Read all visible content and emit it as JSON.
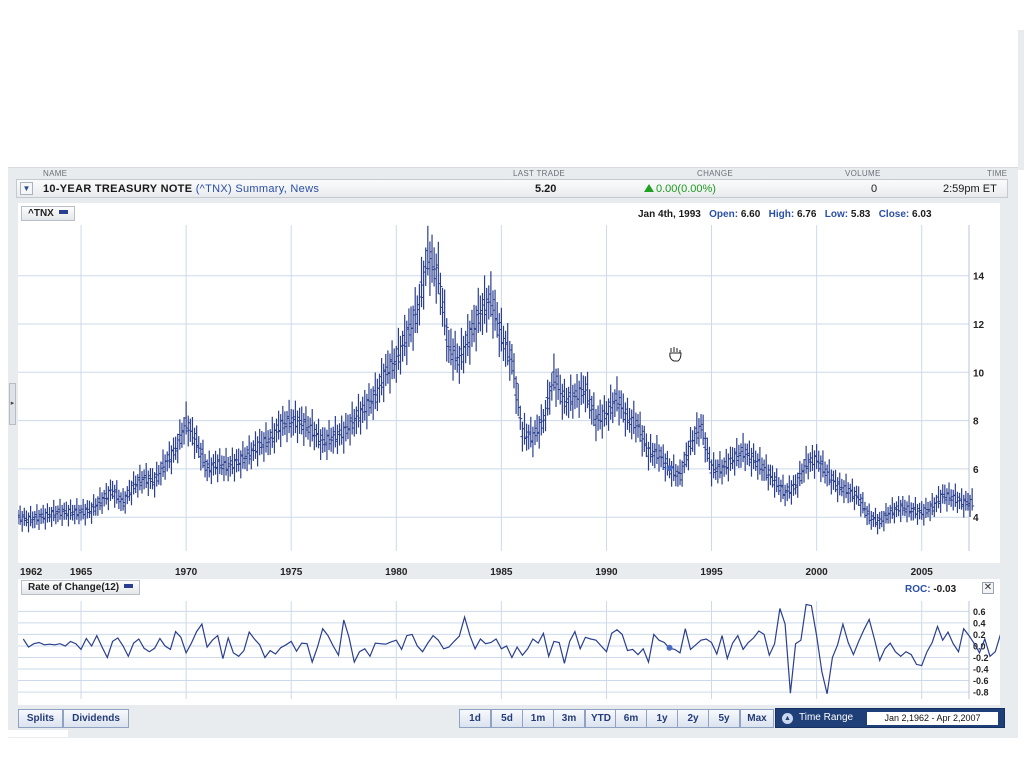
{
  "header": {
    "columns": {
      "name": "NAME",
      "last_trade": "LAST TRADE",
      "change": "CHANGE",
      "volume": "VOLUME",
      "time": "TIME"
    },
    "security_name": "10-YEAR TREASURY NOTE",
    "symbol": "(^TNX)",
    "link_summary": "Summary",
    "link_separator": ",",
    "link_news": "News",
    "last_trade": "5.20",
    "change": "0.00(0.00%)",
    "volume": "0",
    "time": "2:59pm ET"
  },
  "main_chart": {
    "badge": "^TNX",
    "info": {
      "date": "Jan 4th, 1993",
      "open_label": "Open:",
      "open": "6.60",
      "high_label": "High:",
      "high": "6.76",
      "low_label": "Low:",
      "low": "5.83",
      "close_label": "Close:",
      "close": "6.03"
    }
  },
  "roc_chart": {
    "badge": "Rate of Change(12)",
    "value_label": "ROC:",
    "value": "-0.03"
  },
  "close_symbol": "✕",
  "toolbar": {
    "splits": "Splits",
    "dividends": "Dividends",
    "ranges": [
      "1d",
      "5d",
      "1m",
      "3m",
      "YTD",
      "6m",
      "1y",
      "2y",
      "5y",
      "Max"
    ],
    "time_range_label": "Time Range",
    "time_range_value": "Jan 2,1962 - Apr 2,2007"
  },
  "colors": {
    "line": "#2a3f8f",
    "grid": "#cdd9ea",
    "accent": "#1f3f78",
    "up": "#20a020"
  },
  "icons": {
    "hand_cursor": "hand-icon"
  },
  "chart_data": [
    {
      "type": "line",
      "series_style": "ohlc-bars",
      "title": "",
      "xlabel": "",
      "ylabel": "",
      "x_ticks": [
        1962,
        1965,
        1970,
        1975,
        1980,
        1985,
        1990,
        1995,
        2000,
        2005
      ],
      "y_ticks": [
        4,
        6,
        8,
        10,
        12,
        14
      ],
      "xlim": [
        1962,
        2007.25
      ],
      "ylim": [
        2.6,
        16.1
      ],
      "y_axis_position": "right",
      "grid": true,
      "x": [
        1962,
        1962.5,
        1963,
        1963.5,
        1964,
        1964.5,
        1965,
        1965.5,
        1966,
        1966.5,
        1967,
        1967.5,
        1968,
        1968.5,
        1969,
        1969.5,
        1970,
        1970.5,
        1971,
        1971.5,
        1972,
        1972.5,
        1973,
        1973.5,
        1974,
        1974.5,
        1975,
        1975.5,
        1976,
        1976.5,
        1977,
        1977.5,
        1978,
        1978.5,
        1979,
        1979.5,
        1980,
        1980.5,
        1981,
        1981.5,
        1982,
        1982.5,
        1983,
        1983.5,
        1984,
        1984.5,
        1985,
        1985.5,
        1986,
        1986.5,
        1987,
        1987.5,
        1988,
        1988.5,
        1989,
        1989.5,
        1990,
        1990.5,
        1991,
        1991.5,
        1992,
        1992.5,
        1993,
        1993.5,
        1994,
        1994.5,
        1995,
        1995.5,
        1996,
        1996.5,
        1997,
        1997.5,
        1998,
        1998.5,
        1999,
        1999.5,
        2000,
        2000.5,
        2001,
        2001.5,
        2002,
        2002.5,
        2003,
        2003.5,
        2004,
        2004.5,
        2005,
        2005.5,
        2006,
        2006.5,
        2007
      ],
      "values": [
        4.0,
        3.9,
        4.0,
        4.1,
        4.2,
        4.2,
        4.2,
        4.3,
        4.7,
        5.1,
        4.6,
        5.3,
        5.6,
        5.5,
        6.2,
        6.8,
        7.9,
        7.1,
        6.0,
        6.2,
        6.1,
        6.3,
        6.6,
        7.0,
        7.2,
        7.8,
        8.0,
        7.9,
        7.6,
        7.1,
        7.3,
        7.5,
        8.0,
        8.5,
        9.0,
        10.0,
        10.5,
        11.5,
        12.5,
        14.8,
        14.0,
        11.0,
        10.5,
        11.5,
        12.5,
        13.0,
        11.5,
        10.5,
        7.5,
        7.3,
        8.0,
        9.8,
        8.8,
        9.0,
        9.3,
        8.0,
        8.3,
        8.9,
        8.1,
        7.8,
        6.7,
        6.6,
        6.0,
        5.7,
        7.0,
        7.8,
        6.0,
        6.0,
        6.4,
        6.7,
        6.4,
        6.0,
        5.5,
        5.0,
        5.3,
        6.2,
        6.4,
        5.8,
        5.3,
        5.1,
        4.8,
        4.0,
        3.8,
        4.2,
        4.4,
        4.3,
        4.2,
        4.4,
        4.9,
        4.8,
        4.6
      ],
      "highlight": {
        "x": 1993.0,
        "y": 6.03
      }
    },
    {
      "type": "line",
      "title": "",
      "series": [
        {
          "name": "Rate of Change(12)"
        }
      ],
      "y_ticks": [
        0.6,
        0.4,
        0.2,
        0.0,
        -0.2,
        -0.4,
        -0.6,
        -0.8
      ],
      "ylim": [
        -0.92,
        0.78
      ],
      "y_axis_position": "right",
      "grid": true,
      "xlim": [
        1962,
        2007.25
      ],
      "x_start": 1962.25,
      "x_step": 0.25,
      "values": [
        0.12,
        -0.02,
        0.04,
        0.06,
        0.02,
        0.03,
        0.02,
        0.04,
        0.0,
        0.08,
        0.04,
        -0.06,
        0.13,
        0.0,
        0.18,
        -0.02,
        -0.2,
        0.08,
        0.14,
        0.0,
        -0.18,
        0.05,
        0.12,
        -0.04,
        -0.1,
        -0.04,
        0.13,
        0.0,
        -0.06,
        0.25,
        0.15,
        -0.12,
        0.05,
        0.25,
        0.38,
        -0.02,
        0.1,
        0.18,
        -0.22,
        0.14,
        -0.12,
        -0.18,
        -0.08,
        0.24,
        0.12,
        0.02,
        -0.2,
        -0.08,
        -0.14,
        -0.03,
        0.02,
        0.08,
        -0.09,
        0.05,
        0.04,
        -0.28,
        -0.02,
        0.3,
        0.18,
        0.0,
        -0.16,
        0.45,
        0.15,
        -0.28,
        -0.1,
        -0.05,
        -0.18,
        0.05,
        0.04,
        0.03,
        0.07,
        0.1,
        -0.06,
        0.18,
        0.2,
        0.0,
        -0.1,
        0.05,
        0.18,
        0.1,
        -0.05,
        -0.02,
        0.08,
        0.17,
        0.5,
        0.18,
        -0.05,
        0.12,
        0.04,
        0.06,
        0.12,
        -0.05,
        0.0,
        -0.2,
        -0.02,
        -0.16,
        -0.05,
        0.12,
        0.05,
        0.22,
        -0.18,
        0.08,
        0.06,
        -0.3,
        0.08,
        0.25,
        -0.05,
        0.15,
        0.12,
        0.1,
        0.0,
        -0.1,
        0.22,
        0.28,
        0.2,
        -0.08,
        -0.06,
        -0.15,
        -0.05,
        -0.28,
        0.2,
        0.1,
        0.06,
        -0.04,
        -0.06,
        -0.12,
        0.3,
        -0.06,
        0.02,
        0.1,
        0.12,
        0.06,
        -0.14,
        0.18,
        -0.22,
        0.05,
        0.18,
        -0.06,
        0.06,
        0.14,
        0.26,
        0.2,
        -0.16,
        0.04,
        0.65,
        0.38,
        -0.82,
        0.04,
        0.1,
        0.72,
        0.7,
        0.18,
        -0.45,
        -0.83,
        -0.2,
        0.02,
        0.38,
        0.06,
        -0.15,
        0.08,
        0.28,
        0.46,
        0.12,
        -0.25,
        -0.05,
        0.05,
        -0.1,
        -0.18,
        -0.1,
        -0.15,
        -0.32,
        -0.34,
        -0.1,
        0.06,
        0.34,
        0.1,
        0.24,
        0.04,
        -0.1,
        0.3,
        0.18,
        0.04,
        -0.12,
        0.12,
        -0.18,
        -0.1,
        0.2,
        0.05,
        0.02,
        -0.18,
        0.25,
        0.18,
        0.1,
        0.02,
        -0.06,
        0.1,
        0.12,
        -0.08,
        0.04,
        0.06,
        0.02,
        -0.12,
        -0.3,
        -0.48,
        -0.15,
        -0.1,
        -0.1,
        0.02,
        -0.06,
        -0.03,
        -0.1,
        0.02,
        0.2,
        0.05,
        0.44,
        0.25,
        0.35,
        0.18,
        0.1,
        0.0,
        0.1,
        -0.1,
        0.18,
        -0.05,
        -0.2,
        0.2,
        0.1,
        -0.05,
        0.15,
        0.1,
        0.08,
        -0.1,
        0.24,
        -0.4,
        0.25,
        0.1,
        0.05,
        0.12,
        -0.3,
        0.22,
        0.1,
        -0.02,
        0.18,
        -0.18,
        0.1,
        0.2,
        0.02,
        -0.22,
        -0.05,
        0.08,
        0.15,
        -0.05,
        0.2,
        -0.15,
        0.02,
        0.24,
        0.03,
        -0.12,
        -0.12,
        0.38,
        0.1,
        -0.25,
        -0.06,
        0.45,
        0.1,
        -0.15,
        0.06,
        0.18,
        0.02,
        0.06,
        -0.08,
        0.15,
        -0.12,
        0.18,
        -0.1,
        0.1,
        0.05,
        0.18,
        -0.06,
        0.12,
        0.2,
        0.25,
        0.35,
        0.16
      ],
      "highlight": {
        "x": 1993.0,
        "y": -0.03
      }
    }
  ]
}
